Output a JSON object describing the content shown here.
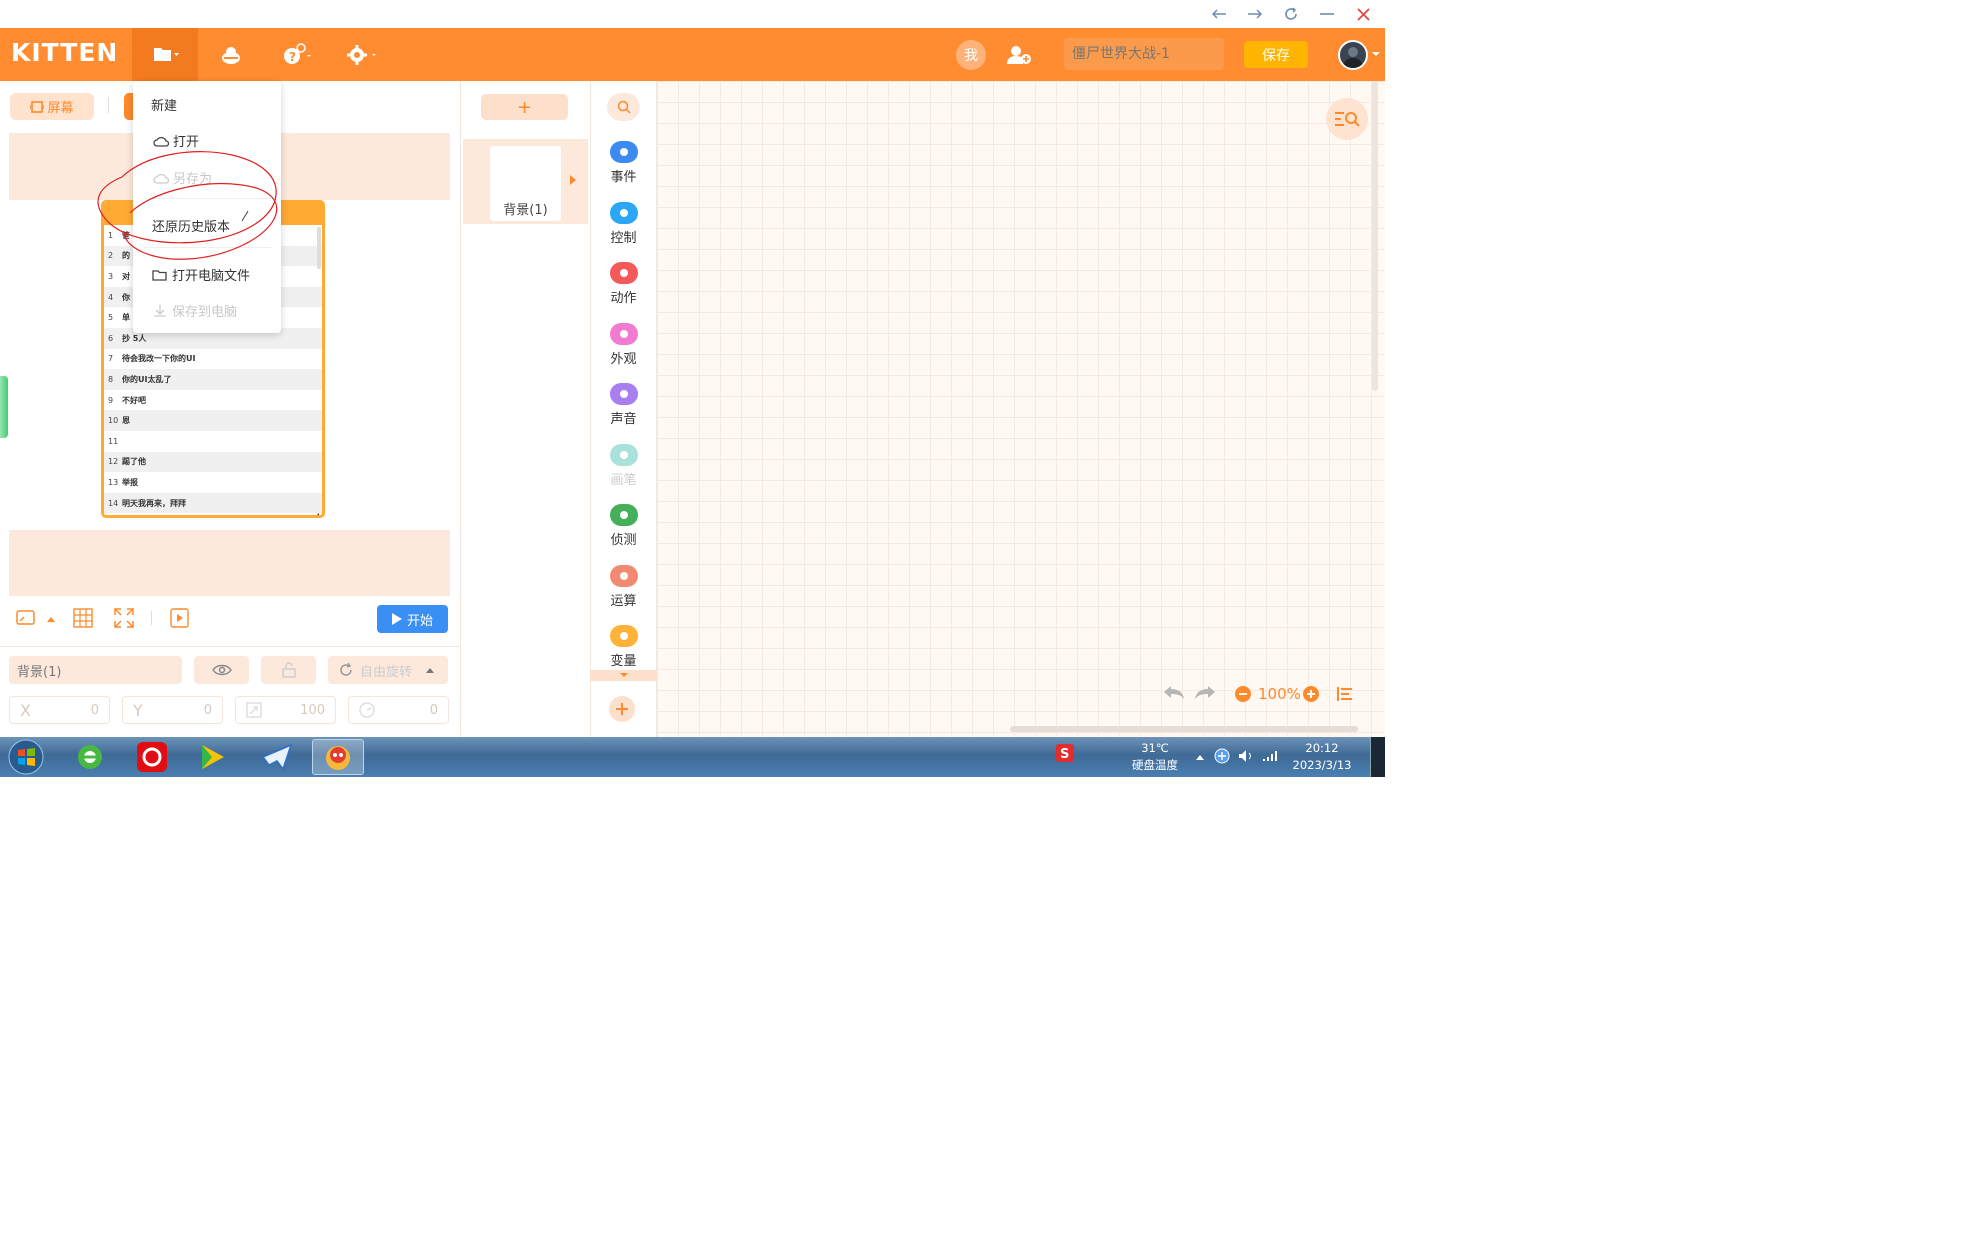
{
  "window": {
    "back_icon": "arrow-left-icon",
    "forward_icon": "arrow-right-icon",
    "refresh_icon": "refresh-icon",
    "minimize_icon": "minimize-icon",
    "close_icon": "close-icon"
  },
  "header": {
    "logo": "KITTEN",
    "me_label": "我",
    "project_name_placeholder": "僵尸世界大战-1",
    "save_label": "保存",
    "accent": "#ff8c30"
  },
  "file_menu": {
    "items": [
      {
        "label": "新建",
        "enabled": true
      },
      {
        "label": "打开",
        "enabled": true
      },
      {
        "label": "另存为",
        "enabled": false
      },
      {
        "label": "还原历史版本",
        "enabled": true
      },
      {
        "label": "打开电脑文件",
        "enabled": true
      },
      {
        "label": "保存到电脑",
        "enabled": false
      }
    ]
  },
  "stage": {
    "screen_label": "屏幕",
    "list_rows": [
      {
        "n": "1",
        "text": "笹"
      },
      {
        "n": "2",
        "text": "的"
      },
      {
        "n": "3",
        "text": "对"
      },
      {
        "n": "4",
        "text": "你"
      },
      {
        "n": "5",
        "text": "单"
      },
      {
        "n": "6",
        "text": "抄  5人"
      },
      {
        "n": "7",
        "text": "待会我改一下你的UI"
      },
      {
        "n": "8",
        "text": "你的UI太乱了"
      },
      {
        "n": "9",
        "text": "不好吧"
      },
      {
        "n": "10",
        "text": "恩"
      },
      {
        "n": "11",
        "text": ""
      },
      {
        "n": "12",
        "text": "踢了他"
      },
      {
        "n": "13",
        "text": "举报"
      },
      {
        "n": "14",
        "text": "明天我再来，拜拜"
      }
    ],
    "start_label": "开始",
    "sprite_name": "背景(1)",
    "rotate_label": "自由旋转",
    "x_label": "X",
    "x_value": "0",
    "y_label": "Y",
    "y_value": "0",
    "size_value": "100",
    "direction_value": "0"
  },
  "sprites": {
    "add_label": "+",
    "background_label": "背景(1)"
  },
  "categories": [
    {
      "label": "事件",
      "color": "#3d8bf2",
      "enabled": true
    },
    {
      "label": "控制",
      "color": "#2aa8f5",
      "enabled": true
    },
    {
      "label": "动作",
      "color": "#f55a5a",
      "enabled": true
    },
    {
      "label": "外观",
      "color": "#f27bd2",
      "enabled": true
    },
    {
      "label": "声音",
      "color": "#a97ef0",
      "enabled": true
    },
    {
      "label": "画笔",
      "color": "#a8e2d8",
      "enabled": false
    },
    {
      "label": "侦测",
      "color": "#44b05a",
      "enabled": true
    },
    {
      "label": "运算",
      "color": "#f08a70",
      "enabled": true
    },
    {
      "label": "变量",
      "color": "#ffb338",
      "enabled": true
    }
  ],
  "code_area": {
    "zoom": "100%"
  },
  "taskbar": {
    "temperature": "31℃",
    "temperature_label": "硬盘温度",
    "time": "20:12",
    "date": "2023/3/13"
  }
}
